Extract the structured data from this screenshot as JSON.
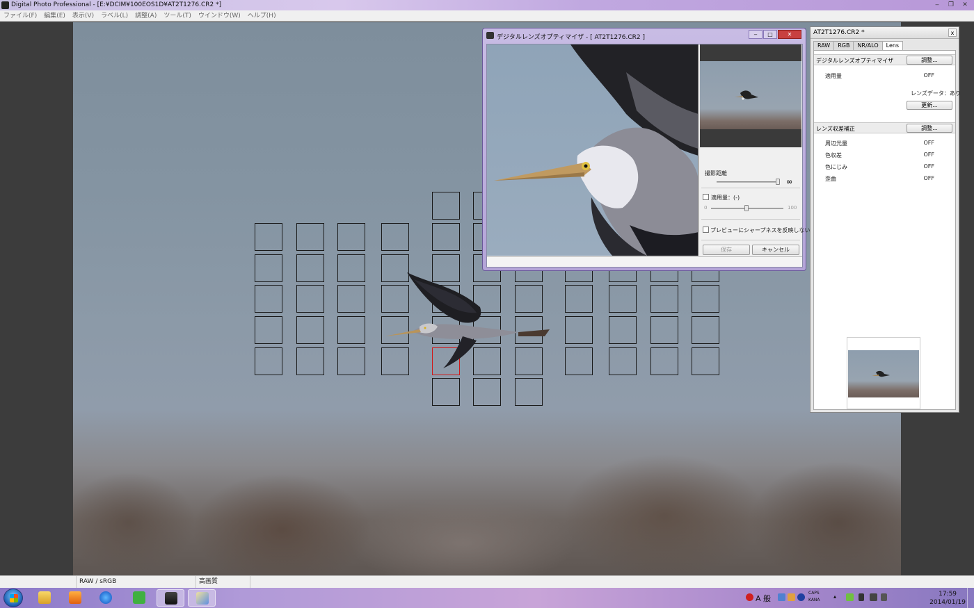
{
  "window": {
    "title": "Digital Photo Professional - [E:¥DCIM¥100EOS1D¥AT2T1276.CR2 *]",
    "minimize": "‒",
    "restore": "❐",
    "close": "✕"
  },
  "menu": [
    "ファイル(F)",
    "編集(E)",
    "表示(V)",
    "ラベル(L)",
    "調整(A)",
    "ツール(T)",
    "ウインドウ(W)",
    "ヘルプ(H)"
  ],
  "dlo": {
    "title": "デジタルレンズオプティマイザ - [ AT2T1276.CR2 ]",
    "minimize": "‒",
    "restore": "□",
    "close": "✕",
    "shooting_distance_label": "撮影距離",
    "infinity": "∞",
    "apply_checkbox_label": "適用量：(-)",
    "slider_min": "0",
    "slider_max": "100",
    "sharpness_checkbox_label": "プレビューにシャープネスを反映しない",
    "save_button": "保存",
    "cancel_button": "キャンセル"
  },
  "palette": {
    "title": "AT2T1276.CR2 *",
    "close": "x",
    "tabs": [
      "RAW",
      "RGB",
      "NR/ALO",
      "Lens"
    ],
    "active_tab": "Lens",
    "dlo_section": {
      "label": "デジタルレンズオプティマイザ",
      "adjust_button": "調整...",
      "apply_label": "適用量",
      "apply_value": "OFF",
      "lens_data": "レンズデータ：あり",
      "update_button": "更新..."
    },
    "aberration_section": {
      "label": "レンズ収差補正",
      "adjust_button": "調整...",
      "rows": [
        {
          "label": "周辺光量",
          "value": "OFF"
        },
        {
          "label": "色収差",
          "value": "OFF"
        },
        {
          "label": "色にじみ",
          "value": "OFF"
        },
        {
          "label": "歪曲",
          "value": "OFF"
        }
      ]
    }
  },
  "statusbar": {
    "color_space": "RAW / sRGB",
    "quality": "高画質"
  },
  "taskbar": {
    "tray_ime": "A 般",
    "caps": "CAPS",
    "kana": "KANA",
    "time": "17:59",
    "date": "2014/01/19"
  },
  "colors": {
    "active_af_point": "#d01818",
    "af_point": "#1a1a1a",
    "taskbar_accent": "#b09ad8"
  }
}
